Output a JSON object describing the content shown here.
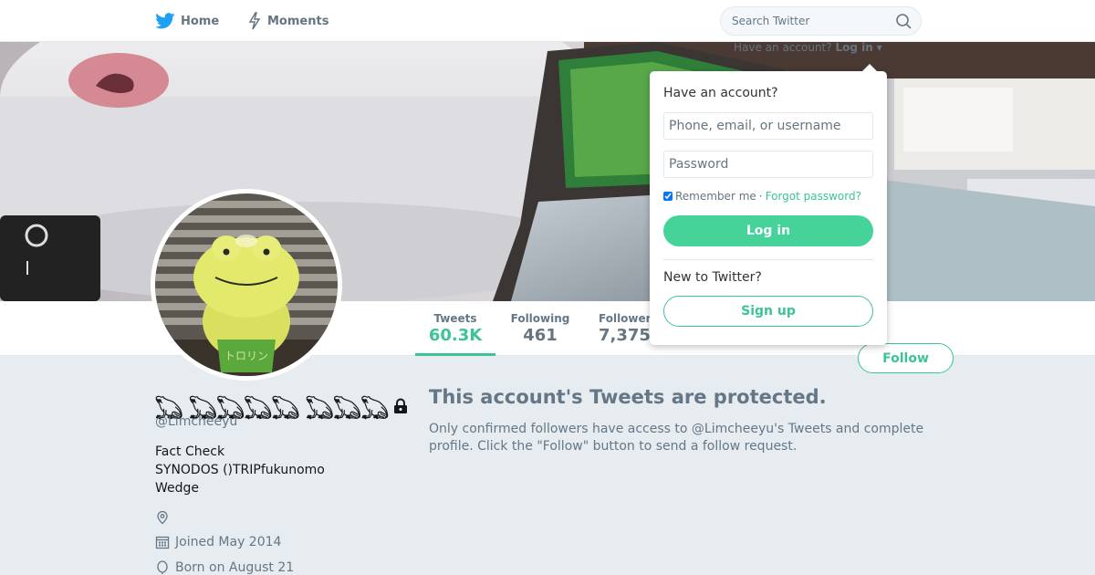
{
  "nav": {
    "home_label": "Home",
    "moments_label": "Moments",
    "search_placeholder": "Search Twitter"
  },
  "login_trigger": {
    "prompt": "Have an account?",
    "link": "Log in"
  },
  "login_dropdown": {
    "heading": "Have an account?",
    "username_placeholder": "Phone, email, or username",
    "password_placeholder": "Password",
    "remember_label": "Remember me",
    "separator": "·",
    "forgot_link": "Forgot password?",
    "login_button": "Log in",
    "new_heading": "New to Twitter?",
    "signup_button": "Sign up"
  },
  "stats": [
    {
      "label": "Tweets",
      "value": "60.3K"
    },
    {
      "label": "Following",
      "value": "461"
    },
    {
      "label": "Followers",
      "value": "7,375"
    }
  ],
  "follow_button": "Follow",
  "profile": {
    "name": "𓆏 𓆏𓆏𓆏𓆏 𓆏𓆏𓆏",
    "handle": "@Limcheeyu",
    "bio_lines": [
      "Fact Check",
      "SYNODOS ()TRIPfukunomo",
      "Wedge"
    ],
    "joined": "Joined May 2014",
    "born": "Born on August 21"
  },
  "protected": {
    "title": "This account's Tweets are protected.",
    "text": "Only confirmed followers have access to @Limcheeyu's Tweets and complete profile. Click the \"Follow\" button to send a follow request."
  },
  "colors": {
    "accent": "#3cc396",
    "login_button": "#46d39a",
    "twitter_blue": "#1da1f2",
    "page_bg": "#e6ecf0"
  },
  "icons": [
    "twitter-bird-icon",
    "lightning-icon",
    "search-icon",
    "lock-icon",
    "location-pin-icon",
    "calendar-icon",
    "balloon-icon"
  ]
}
